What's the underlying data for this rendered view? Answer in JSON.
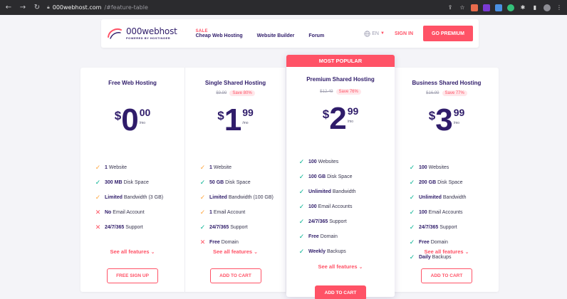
{
  "browser": {
    "url_host": "000webhost.com",
    "url_path": "/#feature-table"
  },
  "header": {
    "logo_name": "000webhost",
    "logo_sub": "POWERED BY HOSTINGER",
    "sale_tag": "SALE",
    "nav": [
      "Cheap Web Hosting",
      "Website Builder",
      "Forum"
    ],
    "lang": "EN",
    "signin": "SIGN IN",
    "go_premium": "GO PREMIUM"
  },
  "colors": {
    "accent": "#ff5266",
    "brand": "#2f1c6a",
    "check": "#00b090",
    "warn": "#ffa43a"
  },
  "featured_banner": "MOST POPULAR",
  "see_all": "See all features",
  "plans": [
    {
      "title": "Free Web Hosting",
      "old_price": "",
      "save": "",
      "currency": "$",
      "price_int": "0",
      "price_frac": "00",
      "per": "/mo",
      "features": [
        {
          "icon": "warn",
          "bold": "1",
          "text": " Website"
        },
        {
          "icon": "check",
          "bold": "300 MB",
          "text": " Disk Space"
        },
        {
          "icon": "warn",
          "bold": "Limited",
          "text": " Bandwidth (3 GB)"
        },
        {
          "icon": "cross",
          "bold": "No",
          "text": " Email Account"
        },
        {
          "icon": "cross",
          "bold": "24/7/365",
          "text": " Support"
        }
      ],
      "cta": "FREE SIGN UP"
    },
    {
      "title": "Single Shared Hosting",
      "old_price": "$9.99",
      "save": "Save 80%",
      "currency": "$",
      "price_int": "1",
      "price_frac": "99",
      "per": "/mo",
      "features": [
        {
          "icon": "warn",
          "bold": "1",
          "text": " Website"
        },
        {
          "icon": "check",
          "bold": "50 GB",
          "text": " Disk Space"
        },
        {
          "icon": "warn",
          "bold": "Limited",
          "text": " Bandwidth (100 GB)"
        },
        {
          "icon": "warn",
          "bold": "1",
          "text": " Email Account"
        },
        {
          "icon": "check",
          "bold": "24/7/365",
          "text": " Support"
        },
        {
          "icon": "cross",
          "bold": "Free",
          "text": " Domain"
        }
      ],
      "cta": "ADD TO CART"
    },
    {
      "title": "Premium Shared Hosting",
      "old_price": "$12.49",
      "save": "Save 76%",
      "currency": "$",
      "price_int": "2",
      "price_frac": "99",
      "per": "/mo",
      "features": [
        {
          "icon": "check",
          "bold": "100",
          "text": " Websites"
        },
        {
          "icon": "check",
          "bold": "100 GB",
          "text": " Disk Space"
        },
        {
          "icon": "check",
          "bold": "Unlimited",
          "text": " Bandwidth"
        },
        {
          "icon": "check",
          "bold": "100",
          "text": " Email Accounts"
        },
        {
          "icon": "check",
          "bold": "24/7/365",
          "text": " Support"
        },
        {
          "icon": "check",
          "bold": "Free",
          "text": " Domain"
        },
        {
          "icon": "check",
          "bold": "Weekly",
          "text": " Backups"
        }
      ],
      "cta": "ADD TO CART"
    },
    {
      "title": "Business Shared Hosting",
      "old_price": "$16.99",
      "save": "Save 77%",
      "currency": "$",
      "price_int": "3",
      "price_frac": "99",
      "per": "/mo",
      "features": [
        {
          "icon": "check",
          "bold": "100",
          "text": " Websites"
        },
        {
          "icon": "check",
          "bold": "200 GB",
          "text": " Disk Space"
        },
        {
          "icon": "check",
          "bold": "Unlimited",
          "text": " Bandwidth"
        },
        {
          "icon": "check",
          "bold": "100",
          "text": " Email Accounts"
        },
        {
          "icon": "check",
          "bold": "24/7/365",
          "text": " Support"
        },
        {
          "icon": "check",
          "bold": "Free",
          "text": " Domain"
        },
        {
          "icon": "check",
          "bold": "Daily",
          "text": " Backups"
        }
      ],
      "cta": "ADD TO CART"
    }
  ]
}
